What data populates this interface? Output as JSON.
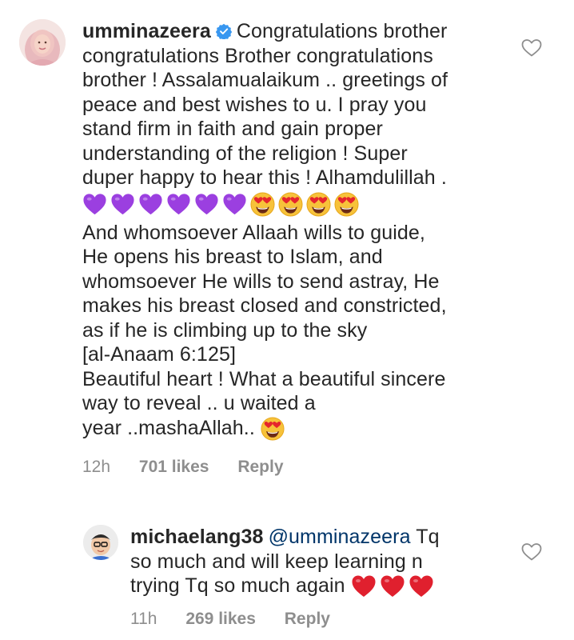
{
  "comments": [
    {
      "username": "umminazeera",
      "verified": true,
      "lines": [
        "Congratulations brother",
        "congratulations Brother congratulations",
        "brother ! Assalamualaikum .. greetings of",
        "peace and best wishes to u. I pray you",
        "stand firm in faith and gain proper",
        "understanding of the religion ! Super",
        "duper happy to hear this ! Alhamdulillah ."
      ],
      "emojis": [
        "purple-heart",
        "purple-heart",
        "purple-heart",
        "purple-heart",
        "purple-heart",
        "purple-heart",
        "heart-eyes",
        "heart-eyes",
        "heart-eyes",
        "heart-eyes"
      ],
      "lines2": [
        "And whomsoever Allaah wills to guide,",
        "He opens his breast to Islam, and",
        "whomsoever He wills to send astray, He",
        "makes his breast closed and constricted,",
        "as if he is climbing up to the sky",
        "[al-Anaam 6:125]",
        "Beautiful heart ! What a beautiful sincere",
        "way to reveal .. u waited a",
        "year ..mashaAllah.."
      ],
      "trailing_emoji": "heart-eyes",
      "time": "12h",
      "likes": "701 likes",
      "reply_label": "Reply",
      "like_icon": "heart-outline-icon"
    },
    {
      "username": "michaelang38",
      "mention": "@umminazeera",
      "first_line_rest": "Tq",
      "lines": [
        "so much and will keep learning n",
        "trying Tq so much again"
      ],
      "emojis": [
        "red-heart",
        "red-heart",
        "red-heart"
      ],
      "time": "11h",
      "likes": "269 likes",
      "reply_label": "Reply",
      "like_icon": "heart-outline-icon"
    }
  ],
  "colors": {
    "text": "#262626",
    "meta": "#8e8e8e",
    "mention": "#003569",
    "verified": "#3897f0",
    "purple_heart": "#9b3fe0",
    "red_heart": "#e0202e"
  }
}
